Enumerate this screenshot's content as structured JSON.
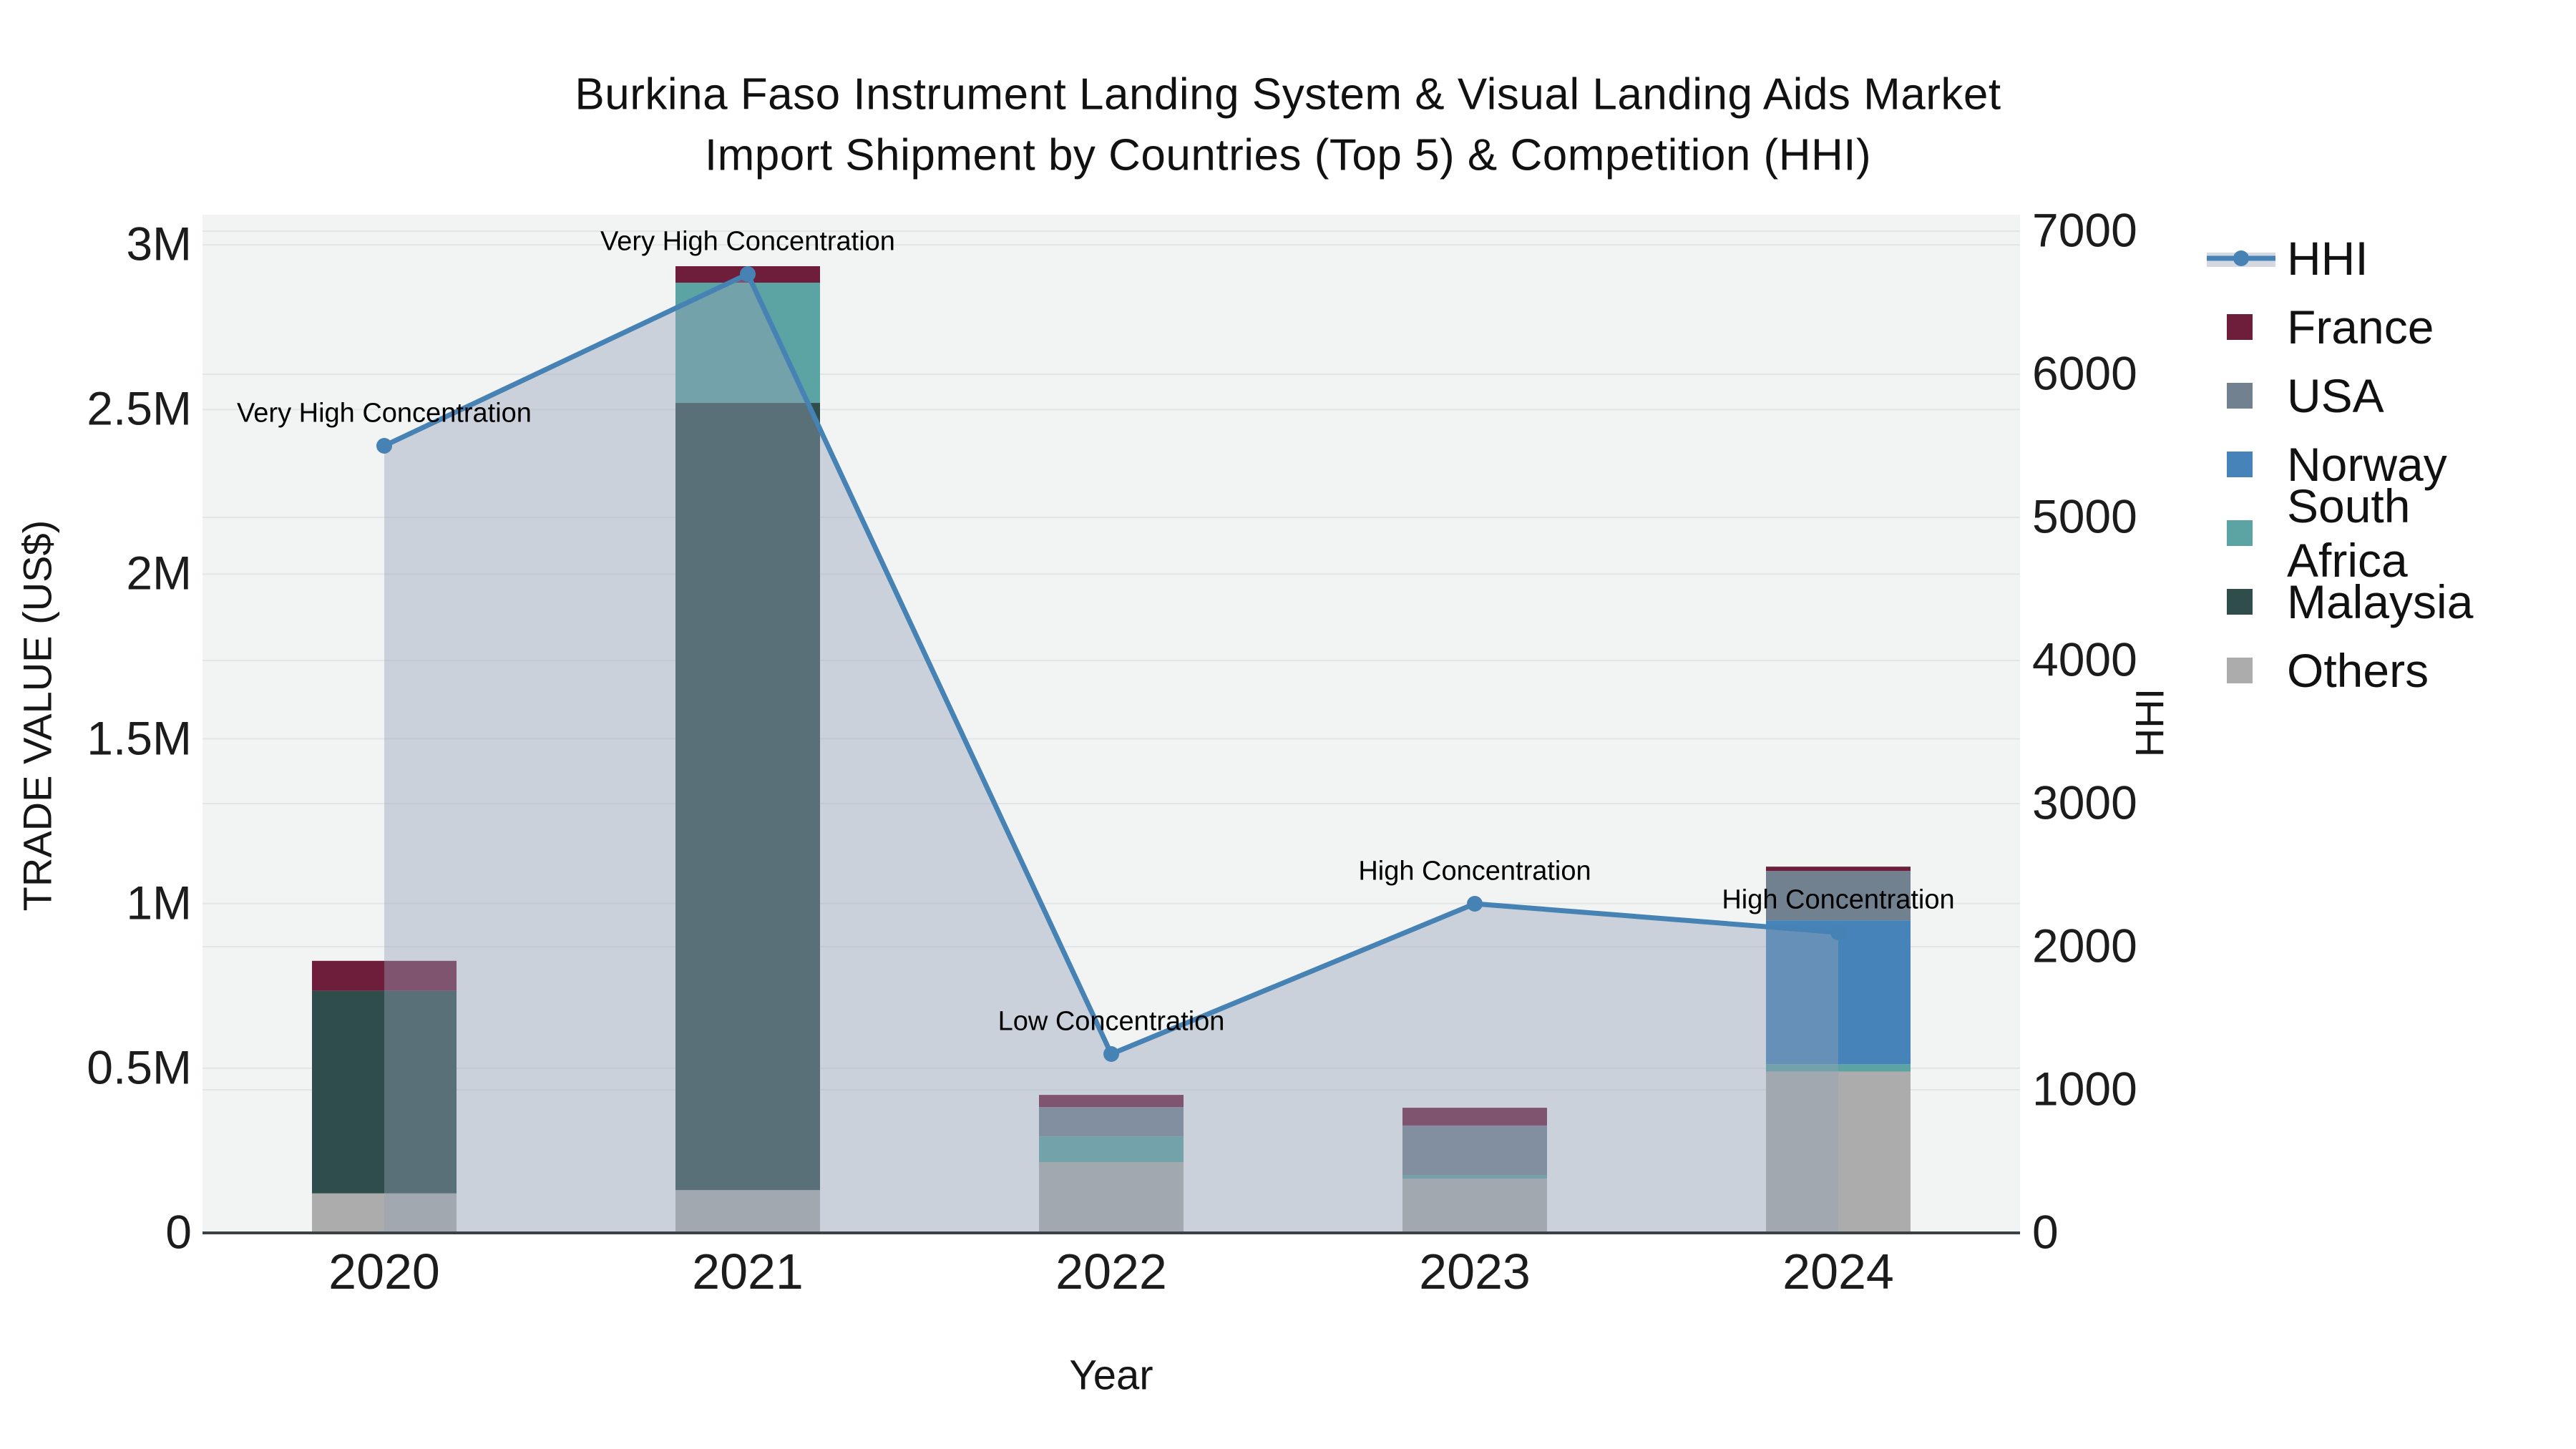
{
  "title": {
    "line1": "Burkina Faso Instrument Landing System & Visual Landing Aids Market",
    "line2": "Import Shipment by Countries (Top 5) & Competition (HHI)"
  },
  "axes": {
    "x": {
      "title": "Year",
      "ticks": [
        "2020",
        "2021",
        "2022",
        "2023",
        "2024"
      ]
    },
    "y_left": {
      "title": "TRADE VALUE (US$)",
      "ticks": [
        {
          "label": "0",
          "value": 0
        },
        {
          "label": "0.5M",
          "value": 0.5
        },
        {
          "label": "1M",
          "value": 1
        },
        {
          "label": "1.5M",
          "value": 1.5
        },
        {
          "label": "2M",
          "value": 2
        },
        {
          "label": "2.5M",
          "value": 2.5
        },
        {
          "label": "3M",
          "value": 3
        }
      ]
    },
    "y_right": {
      "title": "HHI",
      "ticks": [
        {
          "label": "0",
          "value": 0
        },
        {
          "label": "1000",
          "value": 1000
        },
        {
          "label": "2000",
          "value": 2000
        },
        {
          "label": "3000",
          "value": 3000
        },
        {
          "label": "4000",
          "value": 4000
        },
        {
          "label": "5000",
          "value": 5000
        },
        {
          "label": "6000",
          "value": 6000
        },
        {
          "label": "7000",
          "value": 7000
        }
      ]
    }
  },
  "legend": {
    "position": "right",
    "items": [
      {
        "label": "HHI",
        "type": "line-area",
        "color": "#4682b4",
        "band_color": "#d3d8e1"
      },
      {
        "label": "France",
        "type": "square",
        "color": "#6e1d3a"
      },
      {
        "label": "USA",
        "type": "square",
        "color": "#72818f"
      },
      {
        "label": "Norway",
        "type": "square",
        "color": "#4583b8"
      },
      {
        "label": "South Africa",
        "type": "square",
        "color": "#5ca3a3"
      },
      {
        "label": "Malaysia",
        "type": "square",
        "color": "#2e4d4b"
      },
      {
        "label": "Others",
        "type": "square",
        "color": "#abacab"
      }
    ]
  },
  "chart_data": {
    "type": "bar+line",
    "subtype": "stacked-bars-with-secondary-axis-line",
    "categories": [
      "2020",
      "2021",
      "2022",
      "2023",
      "2024"
    ],
    "bar_value_unit": "million US$",
    "stack_order_bottom_to_top": [
      "Others",
      "Malaysia",
      "South Africa",
      "Norway",
      "USA",
      "France"
    ],
    "series": [
      {
        "name": "Others",
        "color": "#abacab",
        "values": [
          0.12,
          0.13,
          0.215,
          0.165,
          0.49
        ]
      },
      {
        "name": "Malaysia",
        "color": "#2e4d4b",
        "values": [
          0.615,
          2.39,
          0,
          0,
          0
        ]
      },
      {
        "name": "South Africa",
        "color": "#5ca3a3",
        "values": [
          0,
          0.365,
          0.078,
          0.011,
          0.022
        ]
      },
      {
        "name": "Norway",
        "color": "#4583b8",
        "values": [
          0,
          0,
          0,
          0,
          0.437
        ]
      },
      {
        "name": "USA",
        "color": "#72818f",
        "values": [
          0,
          0,
          0.089,
          0.15,
          0.15
        ]
      },
      {
        "name": "France",
        "color": "#6e1d3a",
        "values": [
          0.091,
          0.05,
          0.037,
          0.054,
          0.013
        ]
      }
    ],
    "bar_totals": [
      0.83,
      2.94,
      0.42,
      0.38,
      1.11
    ],
    "line_series": {
      "name": "HHI",
      "axis": "right",
      "color": "#4682b4",
      "fill_color": "rgba(150,163,183,0.42)",
      "values": [
        5500,
        6700,
        1250,
        2300,
        2100
      ]
    },
    "annotations": [
      {
        "category": "2020",
        "text": "Very High Concentration"
      },
      {
        "category": "2021",
        "text": "Very High Concentration"
      },
      {
        "category": "2022",
        "text": "Low Concentration"
      },
      {
        "category": "2023",
        "text": "High Concentration"
      },
      {
        "category": "2024",
        "text": "High Concentration"
      }
    ],
    "xlabel": "Year",
    "ylabel_left": "TRADE VALUE (US$)",
    "ylabel_right": "HHI",
    "ylim_left_millions": [
      0,
      3
    ],
    "ylim_right": [
      0,
      7000
    ],
    "grid": true,
    "plot_bg": "#f2f3f3",
    "grid_color": "#e3e6e8",
    "axis_line_color": "#3a4147"
  }
}
